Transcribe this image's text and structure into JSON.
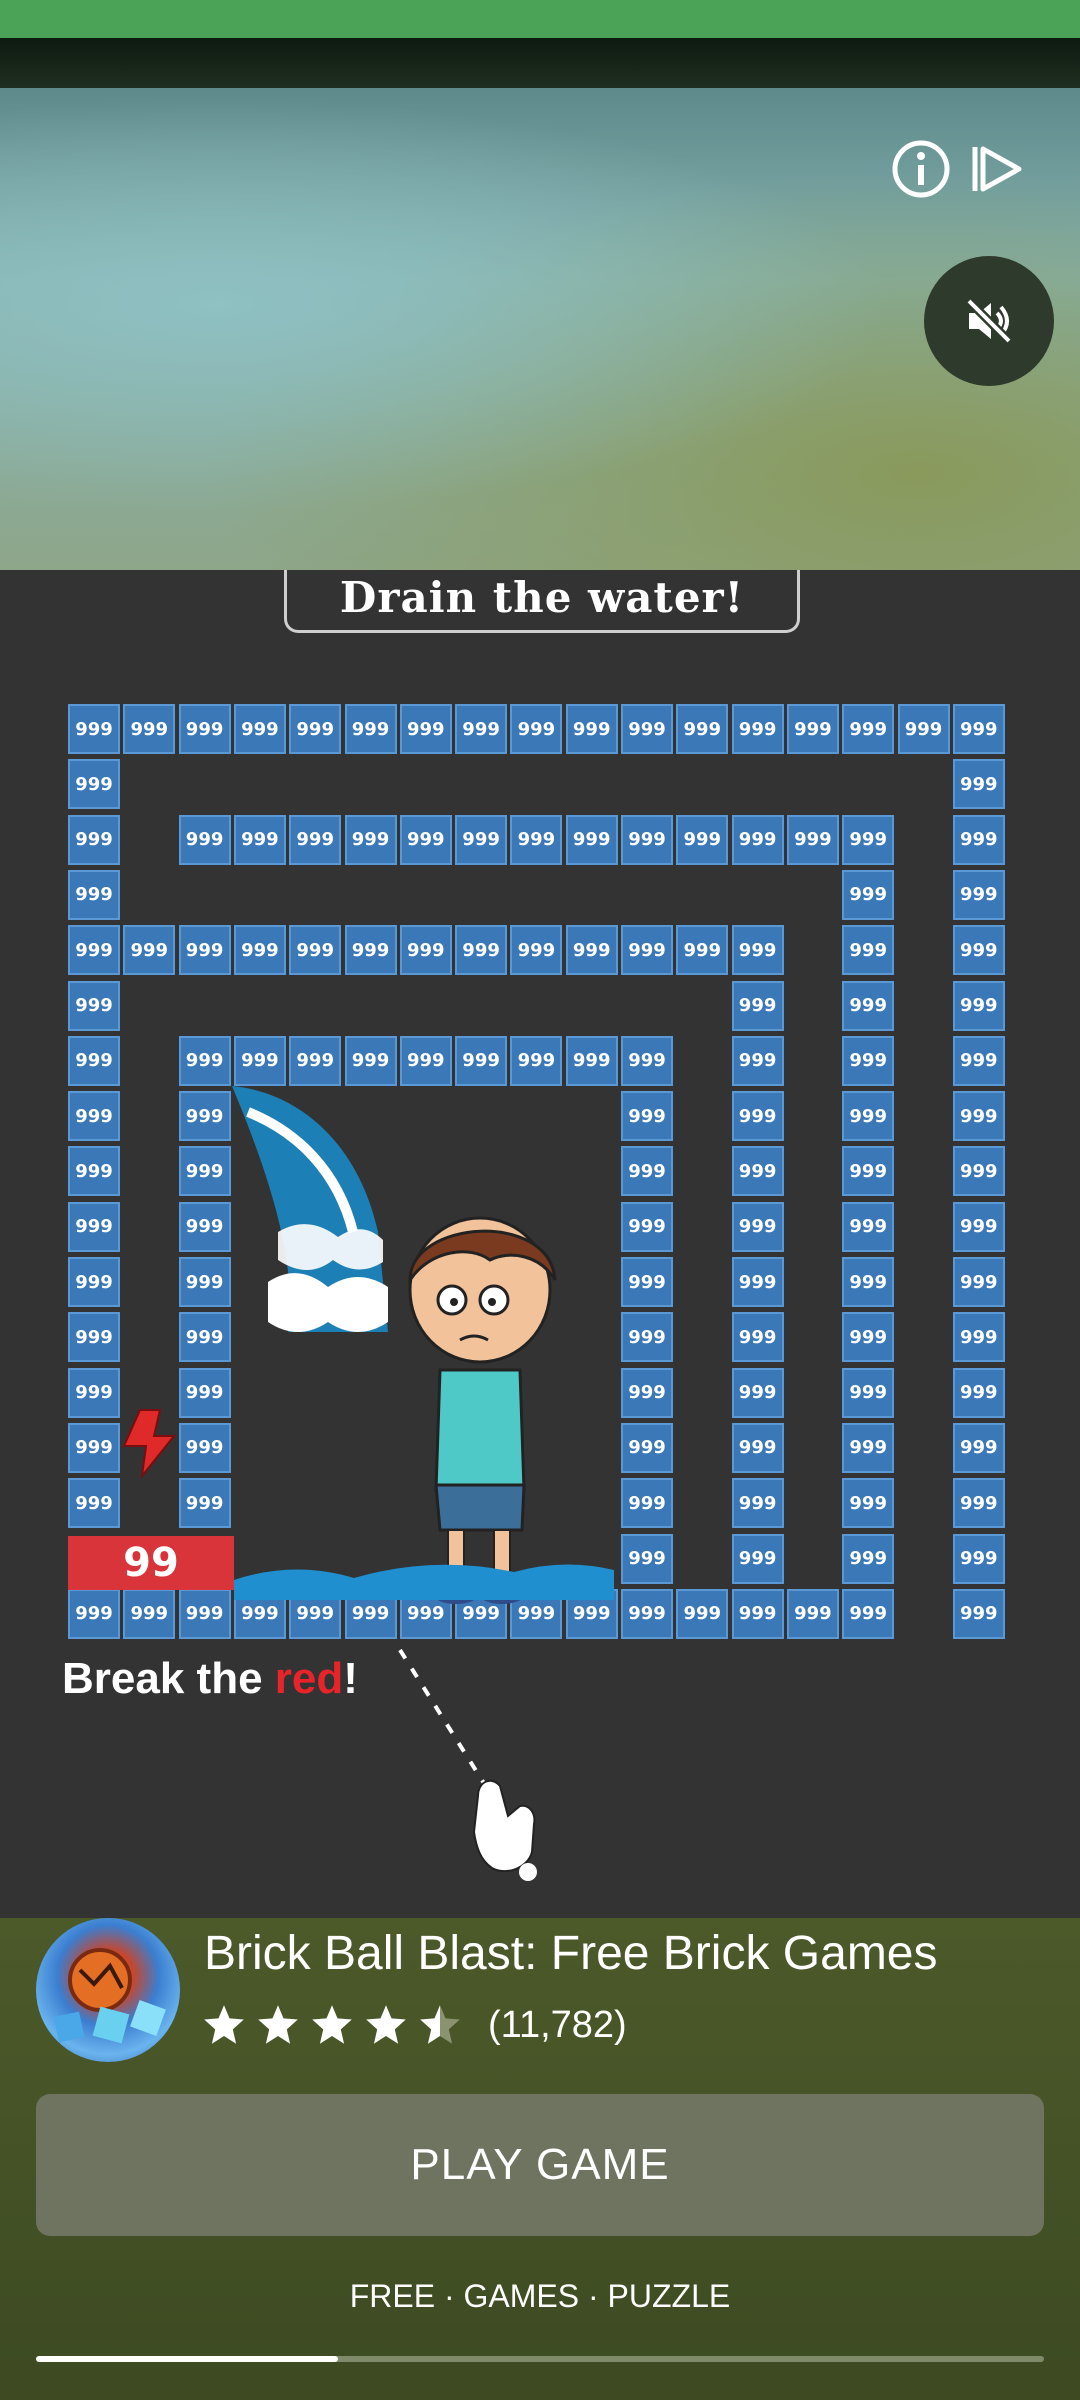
{
  "ad": {
    "headline": "Drain the water!",
    "brick_label": "999",
    "red_brick_label": "99",
    "hint": {
      "prefix": "Break the ",
      "highlight": "red",
      "suffix": "!"
    }
  },
  "controls": {
    "info_icon": "info-icon",
    "skip_icon": "play-skip-icon",
    "mute_icon": "volume-muted-icon"
  },
  "app": {
    "title": "Brick Ball Blast: Free Brick Games",
    "rating": 4.5,
    "rating_count": "(11,782)",
    "cta": "PLAY GAME",
    "tags": "FREE · GAMES · PUZZLE"
  },
  "progress": {
    "fraction": 0.3
  }
}
